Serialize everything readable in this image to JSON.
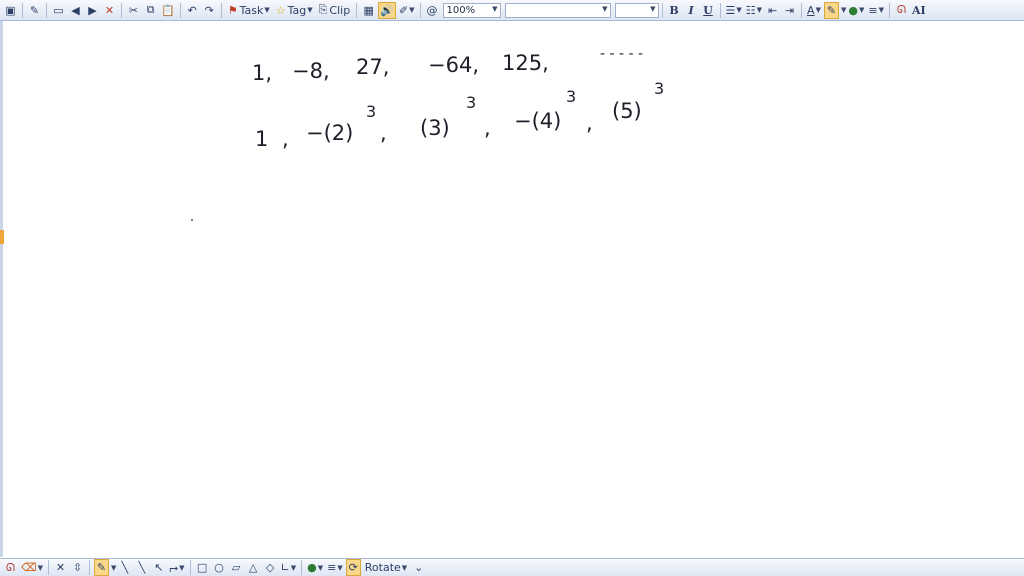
{
  "toolbar": {
    "task_label": "Task",
    "tag_label": "Tag",
    "clip_label": "Clip",
    "zoom_value": "100%",
    "bold_label": "B",
    "italic_label": "I",
    "underline_label": "U",
    "font_color_label": "A",
    "text_label": "AI"
  },
  "bottom_toolbar": {
    "rotate_label": "Rotate"
  },
  "ink": {
    "row1": {
      "t1": "1,",
      "t2": "−8,",
      "t3": "27,",
      "t4": "−64,",
      "t5": "125,",
      "t6": "- - - - -"
    },
    "row2": {
      "t1": "1",
      "c1": ",",
      "t2": "−(2)",
      "e2": "3",
      "c2": ",",
      "t3": "(3)",
      "e3": "3",
      "c3": ",",
      "t4": "−(4)",
      "e4": "3",
      "c4": ",",
      "t5": "(5)",
      "e5": "3"
    }
  },
  "colors": {
    "highlight": "#f7a934",
    "toolbar_bg": "#dde6f3",
    "ink": "#1f1f2a"
  }
}
